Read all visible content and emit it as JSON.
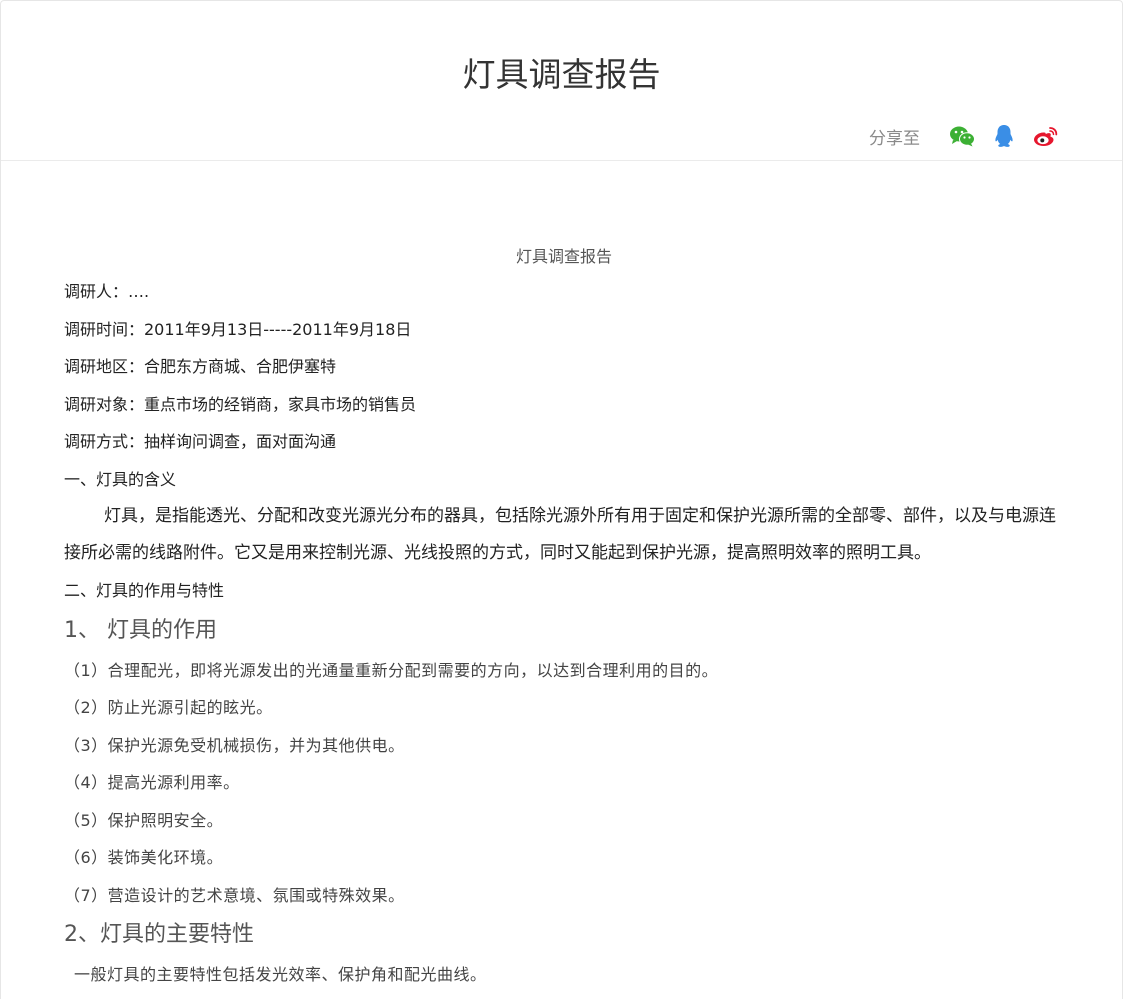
{
  "header": {
    "title": "灯具调查报告",
    "share_label": "分享至",
    "share_icons": [
      "wechat-icon",
      "qq-icon",
      "weibo-icon"
    ],
    "colors": {
      "wechat": "#3cb034",
      "qq": "#3a8ee6",
      "weibo": "#e6162d"
    }
  },
  "doc": {
    "title": "灯具调查报告",
    "meta": [
      "调研人：….",
      "调研时间：2011年9月13日-----2011年9月18日",
      "调研地区：合肥东方商城、合肥伊塞特",
      "调研对象：重点市场的经销商，家具市场的销售员",
      "调研方式：抽样询问调查，面对面沟通"
    ],
    "section1_heading": "一、灯具的含义",
    "section1_para": "灯具，是指能透光、分配和改变光源光分布的器具，包括除光源外所有用于固定和保护光源所需的全部零、部件，以及与电源连接所必需的线路附件。它又是用来控制光源、光线投照的方式，同时又能起到保护光源，提高照明效率的照明工具。",
    "section2_heading": "二、灯具的作用与特性",
    "sub1_heading": "1、 灯具的作用",
    "sub1_items": [
      "（1）合理配光，即将光源发出的光通量重新分配到需要的方向，以达到合理利用的目的。",
      "（2）防止光源引起的眩光。",
      "（3）保护光源免受机械损伤，并为其他供电。",
      "（4）提高光源利用率。",
      "（5）保护照明安全。",
      "（6）装饰美化环境。",
      "（7）营造设计的艺术意境、氛围或特殊效果。"
    ],
    "sub2_heading": "2、灯具的主要特性",
    "sub2_para": "一般灯具的主要特性包括发光效率、保护角和配光曲线。"
  }
}
